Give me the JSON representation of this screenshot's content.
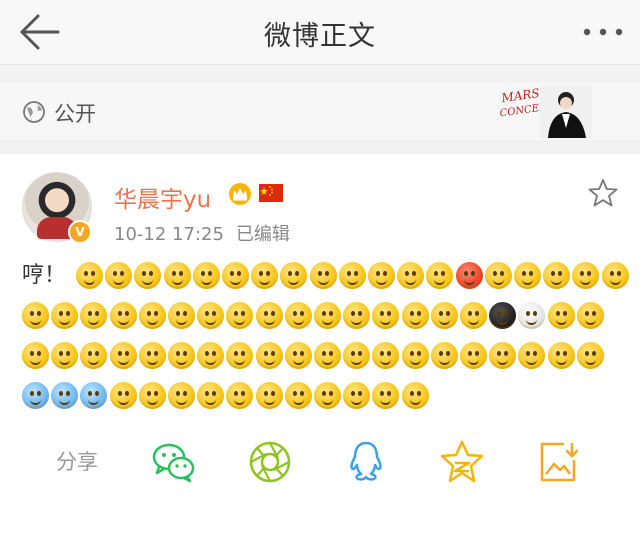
{
  "nav": {
    "title": "微博正文",
    "back_icon": "back-arrow-icon",
    "more_icon": "more-dots-icon"
  },
  "visibility": {
    "label": "公开",
    "icon": "globe-icon",
    "banner_text": "MARS CONCERT"
  },
  "post": {
    "author": "华晨宇yu",
    "verified_badge": "V",
    "badges": [
      "crown-icon",
      "china-flag-icon"
    ],
    "time": "10-12 17:25",
    "edited": "已编辑",
    "text": "哼！",
    "emoji_count": 73,
    "favorite_icon": "star-outline-icon"
  },
  "share": {
    "label": "分享",
    "targets": [
      "wechat",
      "moments",
      "qq",
      "qzone",
      "save"
    ]
  },
  "colors": {
    "username": "#eb7350",
    "wechat": "#2bbf5f",
    "moments": "#8fc31f",
    "qq": "#3aa2e8",
    "qzone": "#f5b400",
    "save": "#f5a623"
  }
}
